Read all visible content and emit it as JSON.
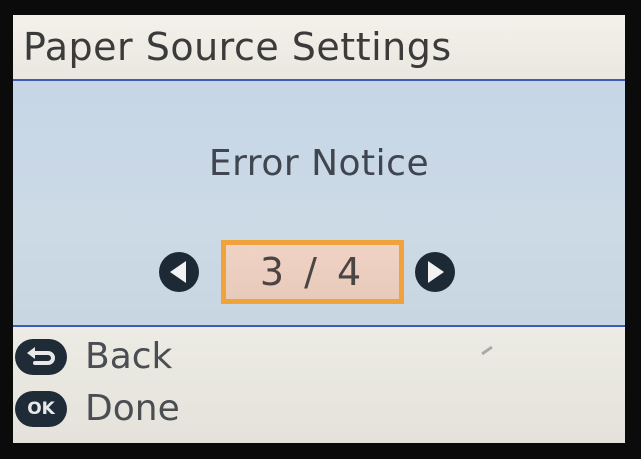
{
  "header": {
    "title": "Paper Source Settings"
  },
  "main": {
    "notice": "Error Notice",
    "pager": {
      "text": "3 / 4",
      "current": 3,
      "total": 4,
      "prev_icon": "left-arrow-icon",
      "next_icon": "right-arrow-icon"
    }
  },
  "footer": {
    "back": {
      "icon": "back-icon",
      "label": "Back"
    },
    "done": {
      "icon": "ok-icon",
      "key_text": "OK",
      "label": "Done"
    }
  },
  "colors": {
    "accent_border": "#f0a33a",
    "divider": "#3d5bb7",
    "screen_bg": "#c9d8e6",
    "icon_fill": "#1d2a35"
  }
}
